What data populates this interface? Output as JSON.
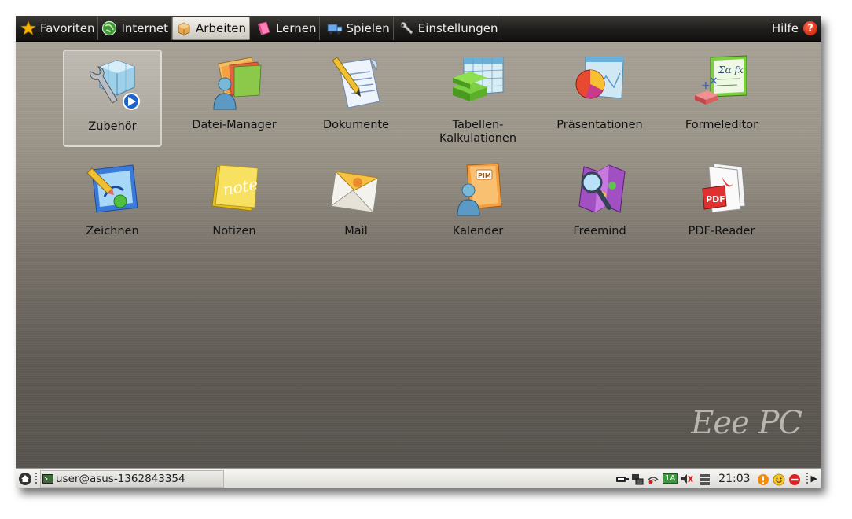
{
  "tabs": [
    {
      "id": "favoriten",
      "label": "Favoriten",
      "icon": "star-icon",
      "active": false
    },
    {
      "id": "internet",
      "label": "Internet",
      "icon": "globe-icon",
      "active": false
    },
    {
      "id": "arbeiten",
      "label": "Arbeiten",
      "icon": "box-icon",
      "active": true
    },
    {
      "id": "lernen",
      "label": "Lernen",
      "icon": "pink-book-icon",
      "active": false
    },
    {
      "id": "spielen",
      "label": "Spielen",
      "icon": "truck-icon",
      "active": false
    },
    {
      "id": "einstellungen",
      "label": "Einstellungen",
      "icon": "wrench-icon",
      "active": false
    }
  ],
  "help": {
    "label": "Hilfe",
    "icon": "help-question-icon",
    "glyph": "?"
  },
  "apps": [
    {
      "label": "Zubehör",
      "icon": "accessories-icon",
      "selected": true
    },
    {
      "label": "Datei-Manager",
      "icon": "file-manager-icon",
      "selected": false
    },
    {
      "label": "Dokumente",
      "icon": "documents-icon",
      "selected": false
    },
    {
      "label": "Tabellen-\nKalkulationen",
      "icon": "spreadsheet-icon",
      "selected": false
    },
    {
      "label": "Präsentationen",
      "icon": "presentation-icon",
      "selected": false
    },
    {
      "label": "Formeleditor",
      "icon": "formula-editor-icon",
      "selected": false
    },
    {
      "label": "Zeichnen",
      "icon": "drawing-icon",
      "selected": false
    },
    {
      "label": "Notizen",
      "icon": "notes-icon",
      "selected": false
    },
    {
      "label": "Mail",
      "icon": "mail-icon",
      "selected": false
    },
    {
      "label": "Kalender",
      "icon": "calendar-pim-icon",
      "selected": false
    },
    {
      "label": "Freemind",
      "icon": "freemind-icon",
      "selected": false
    },
    {
      "label": "PDF-Reader",
      "icon": "pdf-reader-icon",
      "selected": false
    }
  ],
  "brand": "Eee PC",
  "icon_text": {
    "note": "note",
    "pim": "PIM",
    "pdf": "PDF",
    "formula": "Σα fx"
  },
  "taskbar": {
    "window_title": "user@asus-1362843354",
    "clock": "21:03",
    "keyboard_indicator": "1A",
    "tray_icons": [
      "power-plug-icon",
      "network-icon",
      "wifi-icon",
      "keyboard-layout-icon",
      "mute-speaker-icon",
      "storage-icon",
      "warning-icon",
      "smiley-icon",
      "stop-icon"
    ]
  },
  "colors": {
    "active_tab": "#dcd9d0",
    "topbar": "#1e1d1b",
    "desktop": "#8a847a",
    "panel": "#e8e7e3"
  }
}
